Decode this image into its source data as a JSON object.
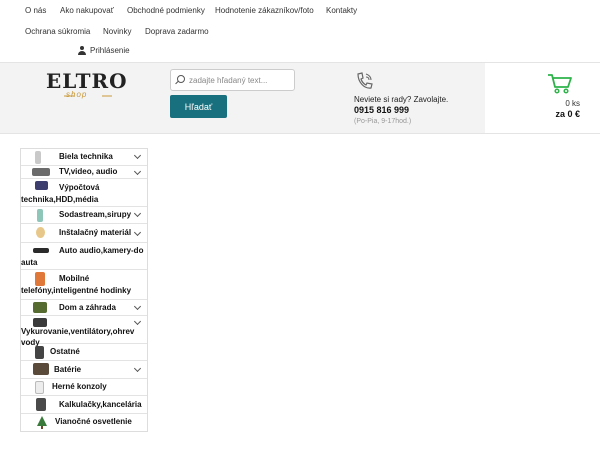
{
  "topnav": {
    "links": [
      "O nás",
      "Ako nakupovať",
      "Obchodné podmienky",
      "Hodnotenie zákazníkov/foto",
      "Kontakty",
      "Ochrana súkromia",
      "Novinky",
      "Doprava zadarmo"
    ],
    "login": "Prihlásenie"
  },
  "logo": {
    "main": "ELTRO",
    "sub": "shop"
  },
  "search": {
    "placeholder": "zadajte hľadaný text...",
    "value": "",
    "button": "Hľadať"
  },
  "contact": {
    "question": "Neviete si rady? Zavolajte.",
    "phone": "0915 816 999",
    "hours": "(Po-Pia, 9-17hod.)"
  },
  "cart": {
    "count": "0 ks",
    "total": "za 0 €"
  },
  "categories": [
    {
      "label": "Biela technika",
      "color": "#c9c9c9",
      "chevron": true
    },
    {
      "label": "TV,video, audio",
      "color": "#6b6b6b",
      "chevron": true
    },
    {
      "label": "Výpočtová technika,HDD,média",
      "color": "#3d3d6e",
      "chevron": false
    },
    {
      "label": "Sodastream,sirupy",
      "color": "#8ec7b9",
      "chevron": true
    },
    {
      "label": "Inštalačný materiál",
      "color": "#e8c88a",
      "chevron": true
    },
    {
      "label": "Auto audio,kamery-do auta",
      "color": "#2b2b2b",
      "chevron": false
    },
    {
      "label": "Mobilné telefóny,inteligentné hodinky",
      "color": "#e0783a",
      "chevron": false
    },
    {
      "label": "Dom a záhrada",
      "color": "#556b2f",
      "chevron": true
    },
    {
      "label": "Vykurovanie,ventilátory,ohrev vody",
      "color": "#3a3a3a",
      "chevron": true
    },
    {
      "label": "Ostatné",
      "color": "#444444",
      "chevron": false
    },
    {
      "label": "Batérie",
      "color": "#5a4a3a",
      "chevron": true
    },
    {
      "label": "Herné konzoly",
      "color": "#ededed",
      "chevron": false
    },
    {
      "label": "Kalkulačky,kancelária",
      "color": "#4a4a4a",
      "chevron": false
    },
    {
      "label": "Vianočné osvetlenie",
      "color": "#3a7a3a",
      "chevron": false
    }
  ],
  "colors": {
    "accent": "#18707e",
    "cart_icon": "#2fb24a",
    "logo_sub": "#c99838"
  }
}
